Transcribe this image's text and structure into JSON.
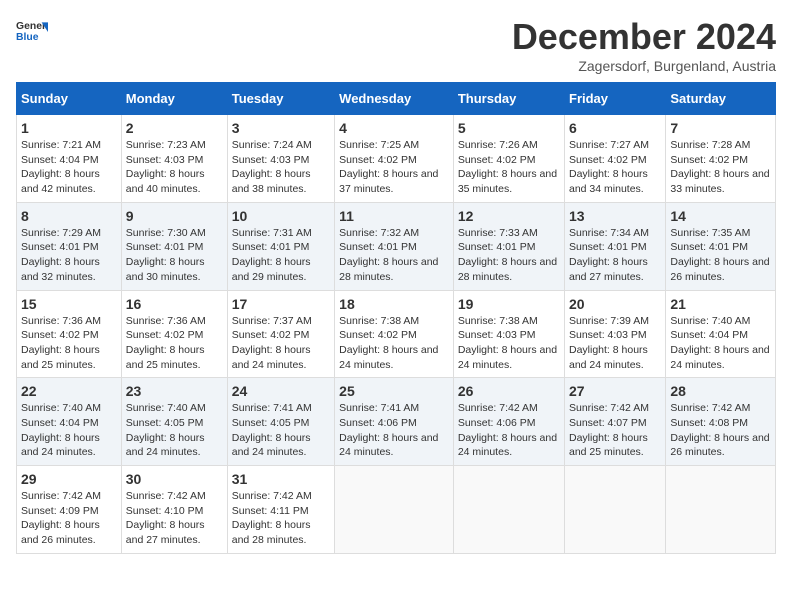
{
  "logo": {
    "general": "General",
    "blue": "Blue"
  },
  "header": {
    "title": "December 2024",
    "subtitle": "Zagersdorf, Burgenland, Austria"
  },
  "weekdays": [
    "Sunday",
    "Monday",
    "Tuesday",
    "Wednesday",
    "Thursday",
    "Friday",
    "Saturday"
  ],
  "weeks": [
    [
      {
        "day": "1",
        "sunrise": "Sunrise: 7:21 AM",
        "sunset": "Sunset: 4:04 PM",
        "daylight": "Daylight: 8 hours and 42 minutes."
      },
      {
        "day": "2",
        "sunrise": "Sunrise: 7:23 AM",
        "sunset": "Sunset: 4:03 PM",
        "daylight": "Daylight: 8 hours and 40 minutes."
      },
      {
        "day": "3",
        "sunrise": "Sunrise: 7:24 AM",
        "sunset": "Sunset: 4:03 PM",
        "daylight": "Daylight: 8 hours and 38 minutes."
      },
      {
        "day": "4",
        "sunrise": "Sunrise: 7:25 AM",
        "sunset": "Sunset: 4:02 PM",
        "daylight": "Daylight: 8 hours and 37 minutes."
      },
      {
        "day": "5",
        "sunrise": "Sunrise: 7:26 AM",
        "sunset": "Sunset: 4:02 PM",
        "daylight": "Daylight: 8 hours and 35 minutes."
      },
      {
        "day": "6",
        "sunrise": "Sunrise: 7:27 AM",
        "sunset": "Sunset: 4:02 PM",
        "daylight": "Daylight: 8 hours and 34 minutes."
      },
      {
        "day": "7",
        "sunrise": "Sunrise: 7:28 AM",
        "sunset": "Sunset: 4:02 PM",
        "daylight": "Daylight: 8 hours and 33 minutes."
      }
    ],
    [
      {
        "day": "8",
        "sunrise": "Sunrise: 7:29 AM",
        "sunset": "Sunset: 4:01 PM",
        "daylight": "Daylight: 8 hours and 32 minutes."
      },
      {
        "day": "9",
        "sunrise": "Sunrise: 7:30 AM",
        "sunset": "Sunset: 4:01 PM",
        "daylight": "Daylight: 8 hours and 30 minutes."
      },
      {
        "day": "10",
        "sunrise": "Sunrise: 7:31 AM",
        "sunset": "Sunset: 4:01 PM",
        "daylight": "Daylight: 8 hours and 29 minutes."
      },
      {
        "day": "11",
        "sunrise": "Sunrise: 7:32 AM",
        "sunset": "Sunset: 4:01 PM",
        "daylight": "Daylight: 8 hours and 28 minutes."
      },
      {
        "day": "12",
        "sunrise": "Sunrise: 7:33 AM",
        "sunset": "Sunset: 4:01 PM",
        "daylight": "Daylight: 8 hours and 28 minutes."
      },
      {
        "day": "13",
        "sunrise": "Sunrise: 7:34 AM",
        "sunset": "Sunset: 4:01 PM",
        "daylight": "Daylight: 8 hours and 27 minutes."
      },
      {
        "day": "14",
        "sunrise": "Sunrise: 7:35 AM",
        "sunset": "Sunset: 4:01 PM",
        "daylight": "Daylight: 8 hours and 26 minutes."
      }
    ],
    [
      {
        "day": "15",
        "sunrise": "Sunrise: 7:36 AM",
        "sunset": "Sunset: 4:02 PM",
        "daylight": "Daylight: 8 hours and 25 minutes."
      },
      {
        "day": "16",
        "sunrise": "Sunrise: 7:36 AM",
        "sunset": "Sunset: 4:02 PM",
        "daylight": "Daylight: 8 hours and 25 minutes."
      },
      {
        "day": "17",
        "sunrise": "Sunrise: 7:37 AM",
        "sunset": "Sunset: 4:02 PM",
        "daylight": "Daylight: 8 hours and 24 minutes."
      },
      {
        "day": "18",
        "sunrise": "Sunrise: 7:38 AM",
        "sunset": "Sunset: 4:02 PM",
        "daylight": "Daylight: 8 hours and 24 minutes."
      },
      {
        "day": "19",
        "sunrise": "Sunrise: 7:38 AM",
        "sunset": "Sunset: 4:03 PM",
        "daylight": "Daylight: 8 hours and 24 minutes."
      },
      {
        "day": "20",
        "sunrise": "Sunrise: 7:39 AM",
        "sunset": "Sunset: 4:03 PM",
        "daylight": "Daylight: 8 hours and 24 minutes."
      },
      {
        "day": "21",
        "sunrise": "Sunrise: 7:40 AM",
        "sunset": "Sunset: 4:04 PM",
        "daylight": "Daylight: 8 hours and 24 minutes."
      }
    ],
    [
      {
        "day": "22",
        "sunrise": "Sunrise: 7:40 AM",
        "sunset": "Sunset: 4:04 PM",
        "daylight": "Daylight: 8 hours and 24 minutes."
      },
      {
        "day": "23",
        "sunrise": "Sunrise: 7:40 AM",
        "sunset": "Sunset: 4:05 PM",
        "daylight": "Daylight: 8 hours and 24 minutes."
      },
      {
        "day": "24",
        "sunrise": "Sunrise: 7:41 AM",
        "sunset": "Sunset: 4:05 PM",
        "daylight": "Daylight: 8 hours and 24 minutes."
      },
      {
        "day": "25",
        "sunrise": "Sunrise: 7:41 AM",
        "sunset": "Sunset: 4:06 PM",
        "daylight": "Daylight: 8 hours and 24 minutes."
      },
      {
        "day": "26",
        "sunrise": "Sunrise: 7:42 AM",
        "sunset": "Sunset: 4:06 PM",
        "daylight": "Daylight: 8 hours and 24 minutes."
      },
      {
        "day": "27",
        "sunrise": "Sunrise: 7:42 AM",
        "sunset": "Sunset: 4:07 PM",
        "daylight": "Daylight: 8 hours and 25 minutes."
      },
      {
        "day": "28",
        "sunrise": "Sunrise: 7:42 AM",
        "sunset": "Sunset: 4:08 PM",
        "daylight": "Daylight: 8 hours and 26 minutes."
      }
    ],
    [
      {
        "day": "29",
        "sunrise": "Sunrise: 7:42 AM",
        "sunset": "Sunset: 4:09 PM",
        "daylight": "Daylight: 8 hours and 26 minutes."
      },
      {
        "day": "30",
        "sunrise": "Sunrise: 7:42 AM",
        "sunset": "Sunset: 4:10 PM",
        "daylight": "Daylight: 8 hours and 27 minutes."
      },
      {
        "day": "31",
        "sunrise": "Sunrise: 7:42 AM",
        "sunset": "Sunset: 4:11 PM",
        "daylight": "Daylight: 8 hours and 28 minutes."
      },
      null,
      null,
      null,
      null
    ]
  ]
}
